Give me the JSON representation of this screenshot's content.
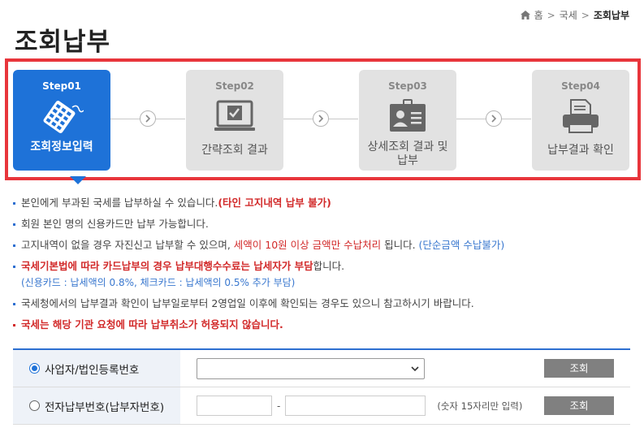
{
  "breadcrumb": {
    "home": "홈",
    "sep1": ">",
    "level1": "국세",
    "sep2": ">",
    "current": "조회납부"
  },
  "page_title": "조회납부",
  "steps": [
    {
      "num": "Step01",
      "label": "조회정보입력",
      "icon": "calculator-icon",
      "active": true
    },
    {
      "num": "Step02",
      "label": "간략조회 결과",
      "icon": "monitor-check-icon",
      "active": false
    },
    {
      "num": "Step03",
      "label": "상세조회 결과 및 납부",
      "icon": "id-card-icon",
      "active": false
    },
    {
      "num": "Step04",
      "label": "납부결과 확인",
      "icon": "printer-icon",
      "active": false
    }
  ],
  "notes": {
    "n1_a": "본인에게 부과된 국세를 납부하실 수 있습니다.",
    "n1_b": "(타인 고지내역 납부 불가)",
    "n2": "회원 본인 명의 신용카드만 납부 가능합니다.",
    "n3_a": "고지내역이 없을 경우 자진신고 납부할 수 있으며, ",
    "n3_b": "세액이 10원 이상 금액만 수납처리",
    "n3_c": " 됩니다. ",
    "n3_d": "(단순금액 수납불가)",
    "n4_a": "국세기본법에 따라 카드납부의 경우 납부대행수수료는 납세자가 부담",
    "n4_b": "합니다.",
    "n4_sub": "(신용카드 : 납세액의 0.8%, 체크카드 : 납세액의 0.5% 추가 부담)",
    "n5": "국세청에서의 납부결과 확인이 납부일로부터 2영업일 이후에 확인되는 경우도 있으니 참고하시기 바랍니다.",
    "n6": "국세는 해당 기관 요청에 따라 납부취소가 허용되지 않습니다."
  },
  "form": {
    "row1": {
      "label": "사업자/법인등록번호",
      "selected": true,
      "select_value": "",
      "button": "조회"
    },
    "row2": {
      "label": "전자납부번호(납부자번호)",
      "selected": false,
      "input1": "",
      "dash": "-",
      "input2": "",
      "hint": "(숫자 15자리만 입력)",
      "button": "조회"
    }
  },
  "colors": {
    "accent": "#1e72d8",
    "frame": "#e8353b",
    "inactive_step": "#e2e2e2",
    "button": "#808080"
  }
}
